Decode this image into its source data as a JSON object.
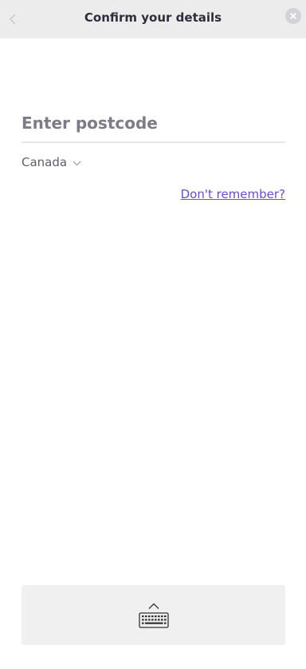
{
  "header": {
    "title": "Confirm your details",
    "back_icon": "chevron-left-icon",
    "close_icon": "close-circle-icon"
  },
  "form": {
    "postcode_placeholder": "Enter postcode",
    "postcode_value": "",
    "country_selected": "Canada",
    "forgot_link": "Don't remember?"
  },
  "keyboard": {
    "icon": "keyboard-icon",
    "toggle_icon": "chevron-up-icon"
  },
  "colors": {
    "header_bg": "#ececed",
    "title_text": "#2e2e3a",
    "placeholder_text": "#7c7b86",
    "link": "#6a4bd7",
    "keyboard_bar_bg": "#f0f0f1"
  }
}
